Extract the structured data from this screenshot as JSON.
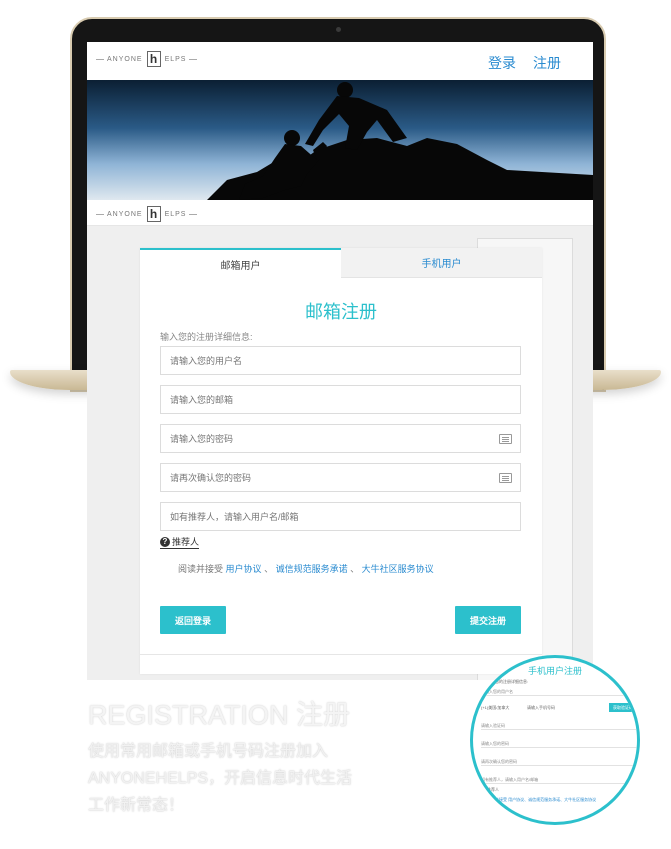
{
  "header": {
    "logo_left": "ANYONE",
    "logo_mark": "h",
    "logo_right": "ELPS",
    "login_label": "登录",
    "register_label": "注册"
  },
  "tabs": [
    {
      "label": "邮箱用户",
      "active": true
    },
    {
      "label": "手机用户",
      "active": false
    }
  ],
  "form": {
    "title": "邮箱注册",
    "hint": "输入您的注册详细信息:",
    "fields": [
      {
        "placeholder": "请输入您的用户名"
      },
      {
        "placeholder": "请输入您的邮箱"
      },
      {
        "placeholder": "请输入您的密码"
      },
      {
        "placeholder": "请再次确认您的密码"
      },
      {
        "placeholder": "如有推荐人，请输入用户名/邮箱"
      }
    ],
    "referrer_label": "推荐人",
    "agree_prefix": "阅读并接受",
    "agree_links": [
      "用户协议",
      "诚信规范服务承诺",
      "大牛社区服务协议"
    ],
    "agree_sep": "、",
    "back_button": "返回登录",
    "submit_button": "提交注册"
  },
  "caption": {
    "title": "REGISTRATION 注册",
    "description": "使用常用邮箱或手机号码注册加入ANYONEHELPS，开启信息时代生活工作新常态！"
  },
  "magnifier": {
    "title": "手机用户注册",
    "lines": [
      "输入您的注册详细信息:",
      "请输入您的用户名",
      "请输入手机号码",
      "请输入验证码",
      "请输入您的密码",
      "请再次确认您的密码",
      "如有推荐人，请输入用户名/邮箱"
    ],
    "country": "(+1)美国/加拿大",
    "code_button": "获取验证码",
    "referrer": "推荐人",
    "agree": "阅读并接受 用户协议、诚信规范服务承诺、大牛社区服务协议"
  },
  "colors": {
    "accent": "#2cc0cc",
    "link": "#2a8bd0"
  }
}
